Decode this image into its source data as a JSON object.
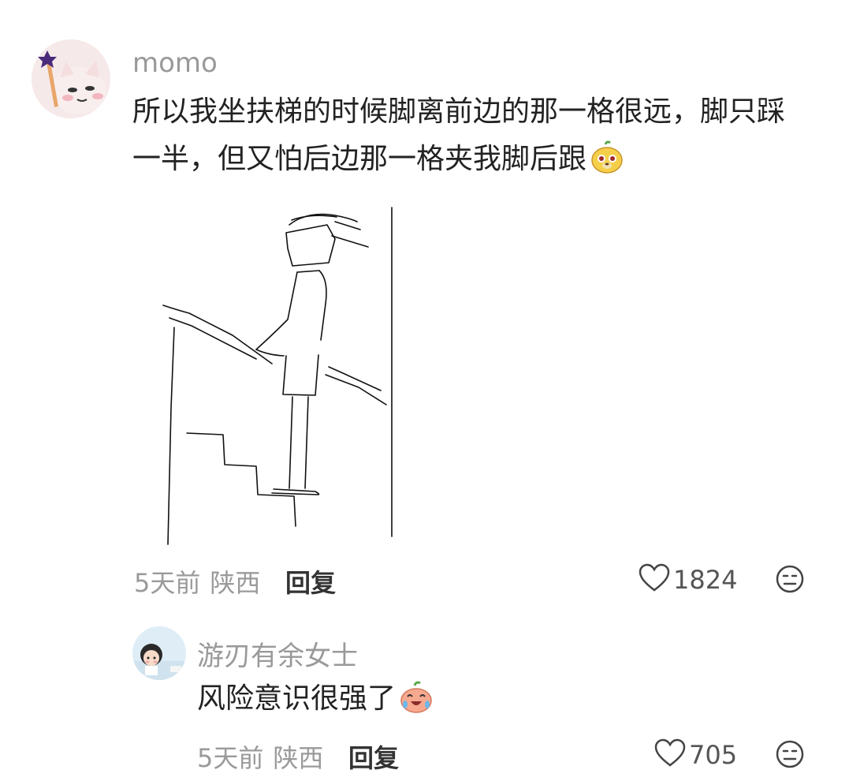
{
  "comments": [
    {
      "username": "momo",
      "text": "所以我坐扶梯的时候脚离前边的那一格很远，脚只踩一半，但又怕后边那一格夹我脚后跟",
      "time": "5天前",
      "location": "陕西",
      "reply_label": "回复",
      "likes": "1824",
      "emoji": "dog-emoji",
      "has_drawing": true
    },
    {
      "username": "游刃有余女士",
      "text": "风险意识很强了",
      "time": "5天前",
      "location": "陕西",
      "reply_label": "回复",
      "likes": "705",
      "emoji": "laughing-cry-emoji"
    }
  ],
  "colors": {
    "username": "#999999",
    "text": "#222222",
    "meta": "#9a9a9a",
    "reply": "#333333"
  }
}
